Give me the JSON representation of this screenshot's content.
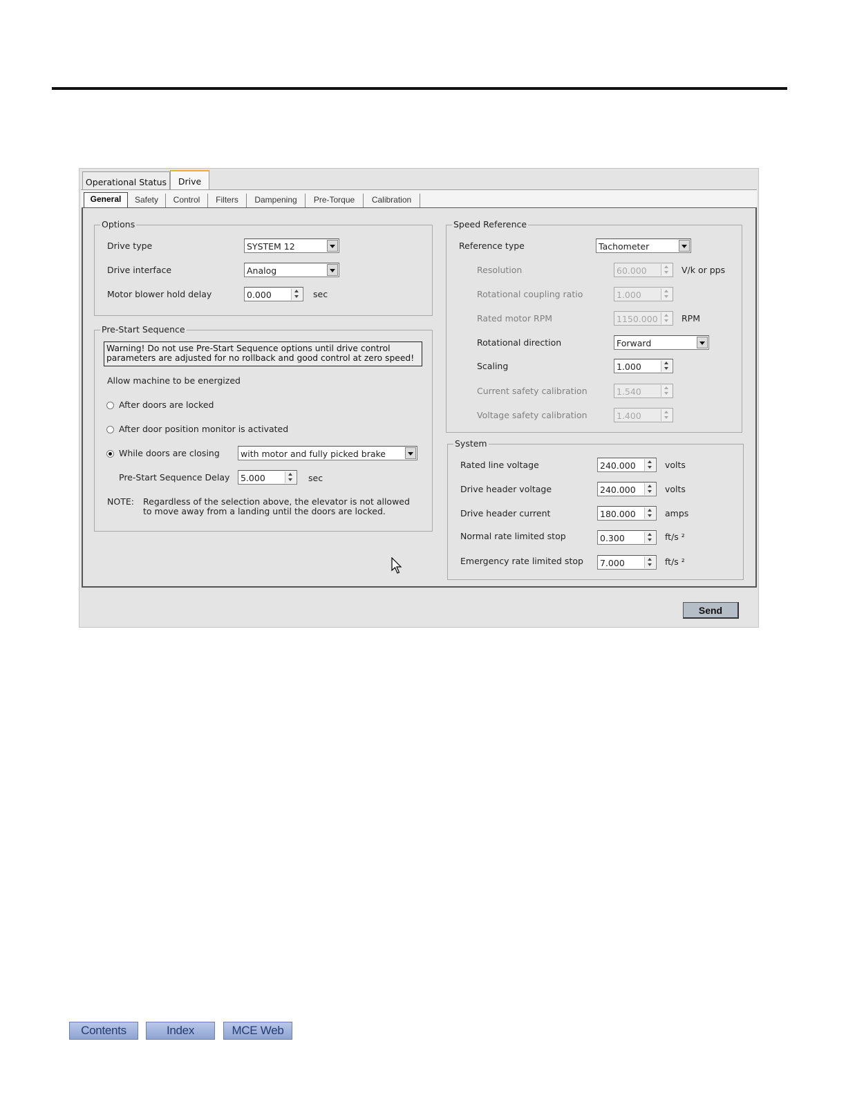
{
  "main_tabs": [
    {
      "label": "Operational Status",
      "active": false
    },
    {
      "label": "Drive",
      "active": true
    }
  ],
  "sub_tabs": [
    {
      "label": "General",
      "active": true
    },
    {
      "label": "Safety",
      "active": false
    },
    {
      "label": "Control",
      "active": false
    },
    {
      "label": "Filters",
      "active": false
    },
    {
      "label": "Dampening",
      "active": false
    },
    {
      "label": "Pre-Torque",
      "active": false
    },
    {
      "label": "Calibration",
      "active": false
    }
  ],
  "options": {
    "title": "Options",
    "drive_type": {
      "label": "Drive type",
      "value": "SYSTEM 12"
    },
    "drive_interface": {
      "label": "Drive interface",
      "value": "Analog"
    },
    "motor_blower_hold_delay": {
      "label": "Motor blower hold delay",
      "value": "0.000",
      "unit": "sec"
    }
  },
  "pre_start": {
    "title": "Pre-Start Sequence",
    "warning_line1": "Warning! Do not use Pre-Start Sequence options until drive control",
    "warning_line2": "parameters are adjusted for no rollback and good control at zero speed!",
    "allow_label": "Allow machine to be energized",
    "radio_options": [
      {
        "label": "After doors are locked",
        "selected": false
      },
      {
        "label": "After door position monitor is activated",
        "selected": false
      },
      {
        "label": "While doors are closing",
        "selected": true
      }
    ],
    "closing_mode": "with motor and fully picked brake",
    "delay_label": "Pre-Start Sequence Delay",
    "delay_value": "5.000",
    "delay_unit": "sec",
    "note_prefix": "NOTE:",
    "note_line1": "Regardless of the selection above, the elevator is not allowed",
    "note_line2": "to move away from a landing until the doors are locked."
  },
  "speed_reference": {
    "title": "Speed Reference",
    "reference_type": {
      "label": "Reference type",
      "value": "Tachometer"
    },
    "resolution": {
      "label": "Resolution",
      "value": "60.000",
      "unit": "V/k or pps",
      "enabled": false
    },
    "rotational_coupling_ratio": {
      "label": "Rotational coupling ratio",
      "value": "1.000",
      "enabled": false
    },
    "rated_motor_rpm": {
      "label": "Rated motor RPM",
      "value": "1150.000",
      "unit": "RPM",
      "enabled": false
    },
    "rotational_direction": {
      "label": "Rotational direction",
      "value": "Forward"
    },
    "scaling": {
      "label": "Scaling",
      "value": "1.000",
      "enabled": true
    },
    "current_safety_calibration": {
      "label": "Current safety calibration",
      "value": "1.540",
      "enabled": false
    },
    "voltage_safety_calibration": {
      "label": "Voltage safety calibration",
      "value": "1.400",
      "enabled": false
    }
  },
  "system": {
    "title": "System",
    "rated_line_voltage": {
      "label": "Rated line voltage",
      "value": "240.000",
      "unit": "volts"
    },
    "drive_header_voltage": {
      "label": "Drive header voltage",
      "value": "240.000",
      "unit": "volts"
    },
    "drive_header_current": {
      "label": "Drive header current",
      "value": "180.000",
      "unit": "amps"
    },
    "normal_rate_limited_stop": {
      "label": "Normal rate limited stop",
      "value": "0.300",
      "unit": "ft/s ²"
    },
    "emergency_rate_limited_stop": {
      "label": "Emergency rate limited stop",
      "value": "7.000",
      "unit": "ft/s ²"
    }
  },
  "send_label": "Send",
  "footer_nav": [
    "Contents",
    "Index",
    "MCE Web"
  ]
}
